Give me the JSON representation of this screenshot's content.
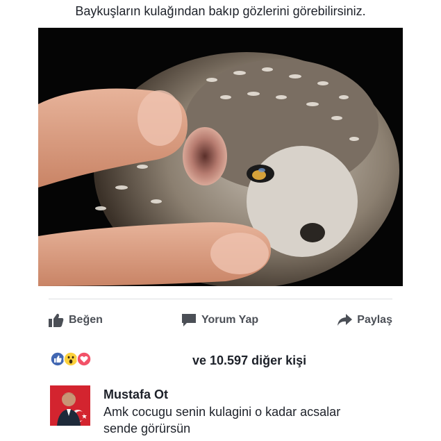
{
  "caption": "Baykuşların kulağından bakıp gözlerini görebilirsiniz.",
  "actions": {
    "like_label": "Beğen",
    "comment_label": "Yorum Yap",
    "share_label": "Paylaş"
  },
  "reactions": {
    "icons": [
      "like-icon",
      "wow-icon",
      "love-icon"
    ],
    "count_text": "ve 10.597 diğer kişi"
  },
  "comment": {
    "author": "Mustafa Ot",
    "text_line1": "Amk cocugu senin kulagini o kadar acsalar",
    "text_line2": "sende görürsün"
  },
  "colors": {
    "facebook_blue": "#4267b2",
    "love_red": "#f25268",
    "wow_yellow": "#fcd13c",
    "action_gray": "#4b4f56",
    "divider": "#dddfe2"
  }
}
